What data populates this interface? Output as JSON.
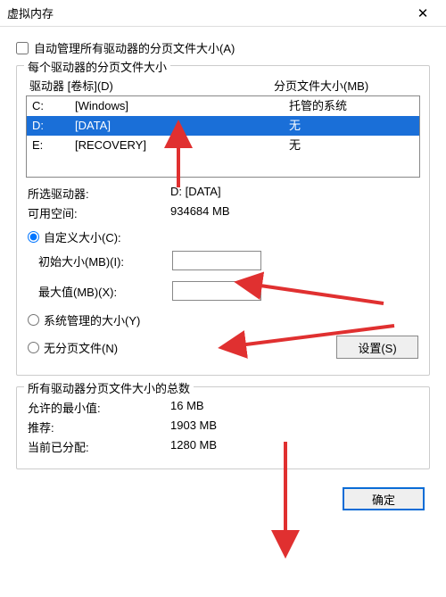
{
  "window": {
    "title": "虚拟内存"
  },
  "auto_manage": {
    "label": "自动管理所有驱动器的分页文件大小(A)"
  },
  "group_drives": {
    "legend": "每个驱动器的分页文件大小",
    "header_drive": "驱动器 [卷标](D)",
    "header_size": "分页文件大小(MB)",
    "rows": [
      {
        "drive": "C:",
        "label": "[Windows]",
        "size": "托管的系统"
      },
      {
        "drive": "D:",
        "label": "[DATA]",
        "size": "无"
      },
      {
        "drive": "E:",
        "label": "[RECOVERY]",
        "size": "无"
      }
    ],
    "selected_drive_label": "所选驱动器:",
    "selected_drive_value": "D:  [DATA]",
    "free_space_label": "可用空间:",
    "free_space_value": "934684 MB",
    "radio_custom": "自定义大小(C):",
    "initial_label": "初始大小(MB)(I):",
    "initial_value": "",
    "max_label": "最大值(MB)(X):",
    "max_value": "",
    "radio_system": "系统管理的大小(Y)",
    "radio_none": "无分页文件(N)",
    "set_button": "设置(S)"
  },
  "group_totals": {
    "legend": "所有驱动器分页文件大小的总数",
    "min_label": "允许的最小值:",
    "min_value": "16 MB",
    "rec_label": "推荐:",
    "rec_value": "1903 MB",
    "cur_label": "当前已分配:",
    "cur_value": "1280 MB"
  },
  "footer": {
    "ok": "确定"
  }
}
